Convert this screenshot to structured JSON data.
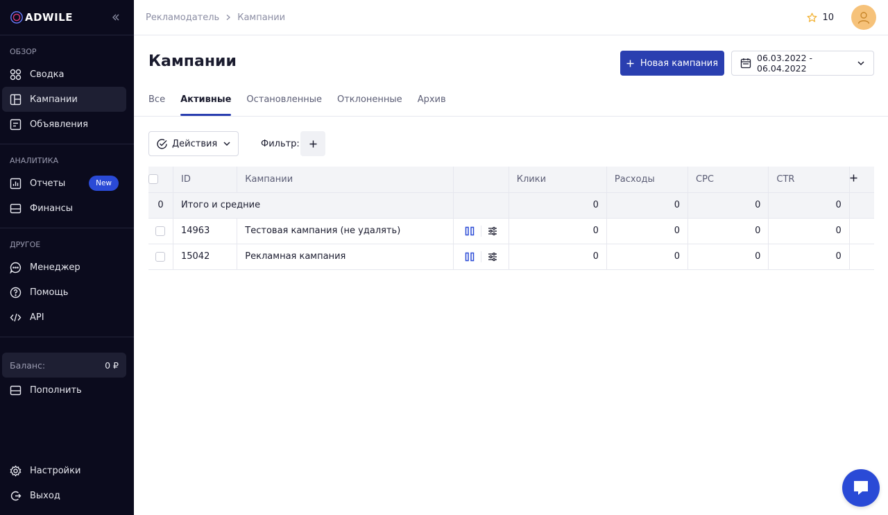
{
  "brand": {
    "logo_text": "ADWILE",
    "accent": "#2a3fb0"
  },
  "sidebar": {
    "sections": [
      {
        "title": "Обзор",
        "items": [
          {
            "label": "Сводка",
            "icon": "grid-icon"
          },
          {
            "label": "Кампании",
            "icon": "layout-icon",
            "active": true
          },
          {
            "label": "Объявления",
            "icon": "ad-icon"
          }
        ]
      },
      {
        "title": "Аналитика",
        "items": [
          {
            "label": "Отчеты",
            "icon": "report-icon",
            "badge": "New"
          },
          {
            "label": "Финансы",
            "icon": "wallet-icon"
          }
        ]
      },
      {
        "title": "Другое",
        "items": [
          {
            "label": "Менеджер",
            "icon": "chat-bubble-icon"
          },
          {
            "label": "Помощь",
            "icon": "help-icon"
          },
          {
            "label": "API",
            "icon": "code-icon"
          }
        ]
      }
    ],
    "balance_label": "Баланс:",
    "balance_value": "0 ₽",
    "topup_label": "Пополнить",
    "settings_label": "Настройки",
    "logout_label": "Выход"
  },
  "topbar": {
    "breadcrumb": [
      "Рекламодатель",
      "Кампании"
    ],
    "stars_count": "10"
  },
  "page": {
    "title": "Кампании",
    "new_campaign_label": "Новая кампания",
    "date_range": "06.03.2022 - 06.04.2022",
    "tabs": [
      "Все",
      "Активные",
      "Остановленные",
      "Отклоненные",
      "Архив"
    ],
    "active_tab": 1,
    "actions_label": "Действия",
    "filter_label": "Фильтр:"
  },
  "table": {
    "headers": {
      "id": "ID",
      "name": "Кампании",
      "clicks": "Клики",
      "expenses": "Расходы",
      "cpc": "CPC",
      "ctr": "CTR"
    },
    "totals": {
      "count": "0",
      "label": "Итого и средние",
      "clicks": "0",
      "expenses": "0",
      "cpc": "0",
      "ctr": "0"
    },
    "rows": [
      {
        "id": "14963",
        "name": "Тестовая кампания (не удалять)",
        "clicks": "0",
        "expenses": "0",
        "cpc": "0",
        "ctr": "0"
      },
      {
        "id": "15042",
        "name": "Рекламная кампания",
        "clicks": "0",
        "expenses": "0",
        "cpc": "0",
        "ctr": "0"
      }
    ]
  }
}
